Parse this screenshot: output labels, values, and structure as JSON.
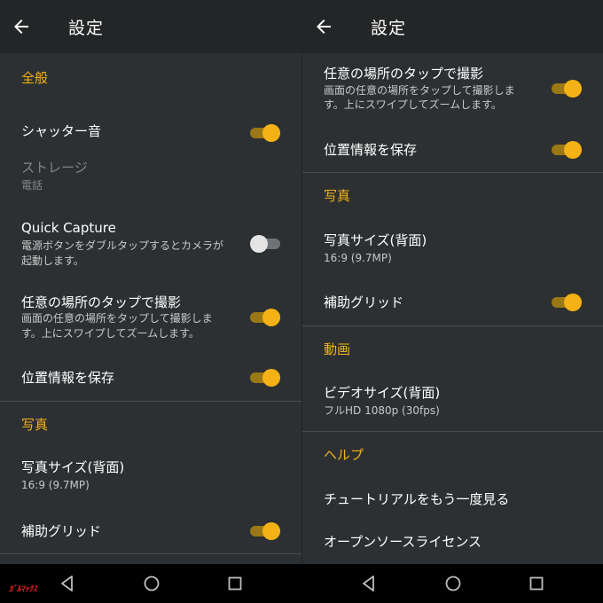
{
  "colors": {
    "accent": "#f1b214",
    "background": "#2d3032",
    "appbar": "#232526"
  },
  "left": {
    "title": "設定",
    "sections": {
      "general": "全般",
      "photo": "写真"
    },
    "items": {
      "shutter": {
        "title": "シャッター音",
        "on": true
      },
      "storage": {
        "title": "ストレージ",
        "subtitle": "電話"
      },
      "quick": {
        "title": "Quick Capture",
        "sub1": "電源ボタンをダブルタップするとカメラが",
        "sub2": "起動します。",
        "on": false
      },
      "tap": {
        "title": "任意の場所のタップで撮影",
        "sub1": "画面の任意の場所をタップして撮影しま",
        "sub2": "す。上にスワイプしてズームします。",
        "on": true
      },
      "location": {
        "title": "位置情報を保存",
        "on": true
      },
      "photo_size": {
        "title": "写真サイズ(背面)",
        "subtitle": "16:9 (9.7MP)"
      },
      "grid": {
        "title": "補助グリッド",
        "on": true
      }
    }
  },
  "right": {
    "title": "設定",
    "sections": {
      "photo": "写真",
      "video": "動画",
      "help": "ヘルプ"
    },
    "items": {
      "tap": {
        "title": "任意の場所のタップで撮影",
        "sub1": "画面の任意の場所をタップして撮影しま",
        "sub2": "す。上にスワイプしてズームします。",
        "on": true
      },
      "location": {
        "title": "位置情報を保存",
        "on": true
      },
      "photo_size": {
        "title": "写真サイズ(背面)",
        "subtitle": "16:9 (9.7MP)"
      },
      "grid": {
        "title": "補助グリッド",
        "on": true
      },
      "video_size": {
        "title": "ビデオサイズ(背面)",
        "subtitle": "フルHD 1080p (30fps)"
      },
      "tutorial": {
        "title": "チュートリアルをもう一度見る"
      },
      "oss": {
        "title": "オープンソースライセンス"
      }
    }
  },
  "navbar": {
    "icons": [
      "back-triangle-icon",
      "home-circle-icon",
      "recents-square-icon"
    ]
  },
  "watermark": "ｶﾞﾙﾏｯｸｽ"
}
